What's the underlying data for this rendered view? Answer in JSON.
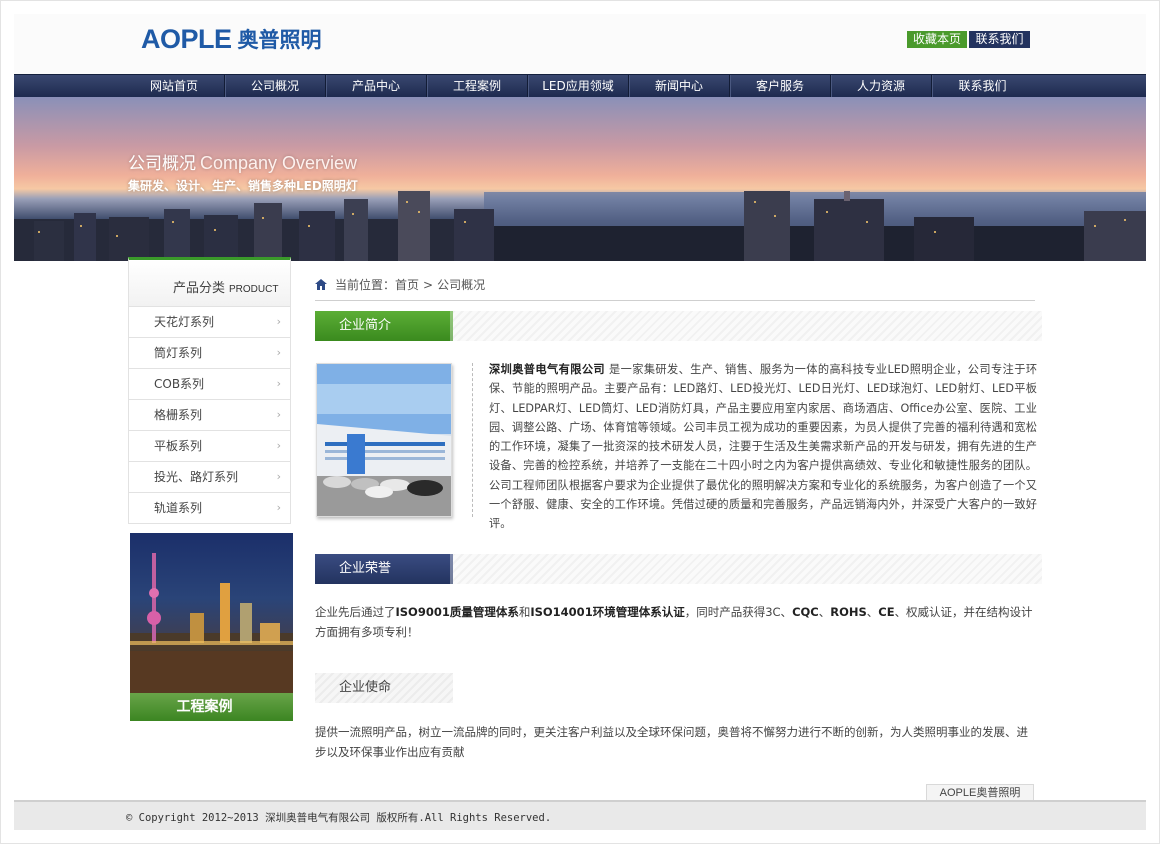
{
  "brand": {
    "logo_en": "AOPLE",
    "logo_cn": "奥普照明",
    "color": "#1f5aa6"
  },
  "toplinks": {
    "favorite": "收藏本页",
    "contact": "联系我们"
  },
  "nav": [
    "网站首页",
    "公司概况",
    "产品中心",
    "工程案例",
    "LED应用领域",
    "新闻中心",
    "客户服务",
    "人力资源",
    "联系我们"
  ],
  "banner": {
    "title_cn": "公司概况",
    "title_en": "Company Overview",
    "subtitle": "集研发、设计、生产、销售多种LED照明灯"
  },
  "sidebar": {
    "heading_cn": "产品分类",
    "heading_en": "PRODUCT",
    "items": [
      "天花灯系列",
      "筒灯系列",
      "COB系列",
      "格栅系列",
      "平板系列",
      "投光、路灯系列",
      "轨道系列"
    ],
    "project_label": "工程案例"
  },
  "breadcrumb": {
    "prefix": "当前位置：",
    "home": "首页",
    "sep": ">",
    "current": "公司概况"
  },
  "sections": {
    "intro": {
      "title": "企业简介",
      "company": "深圳奥普电气有限公司",
      "text": "是一家集研发、生产、销售、服务为一体的高科技专业LED照明企业，公司专注于环保、节能的照明产品。主要产品有：LED路灯、LED投光灯、LED日光灯、LED球泡灯、LED射灯、LED平板灯、LEDPAR灯、LED筒灯、LED消防灯具，产品主要应用室内家居、商场酒店、Office办公室、医院、工业园、调整公路、广场、体育馆等领域。公司丰员工视为成功的重要因素，为员人提供了完善的福利待遇和宽松的工作环境，凝集了一批资深的技术研发人员，注要于生活及生美需求新产品的开发与研发，拥有先进的生产设备、完善的检控系统，并培养了一支能在二十四小时之内为客户提供高绩效、专业化和敏捷性服务的团队。公司工程师团队根据客户要求为企业提供了最优化的照明解决方案和专业化的系统服务，为客户创造了一个又一个舒服、健康、安全的工作环境。凭借过硬的质量和完善服务，产品远销海内外，并深受广大客户的一致好评。"
    },
    "honor": {
      "title": "企业荣誉",
      "text_a": "企业先后通过了",
      "bold_a": "ISO9001质量管理体系",
      "text_b": "和",
      "bold_b": "ISO14001环境管理体系认证",
      "text_c": "，同时产品获得3C、",
      "bold_c": "CQC",
      "text_d": "、",
      "bold_d": "ROHS",
      "text_e": "、",
      "bold_e": "CE",
      "text_f": "、权威认证，并在结构设计方面拥有多项专利！"
    },
    "mission": {
      "title": "企业使命",
      "text": "提供一流照明产品，树立一流品牌的同时，更关注客户利益以及全球环保问题，奥普将不懈努力进行不断的创新，为人类照明事业的发展、进步以及环保事业作出应有贡献"
    }
  },
  "footer": {
    "tab": "AOPLE奥普照明",
    "copyright": "© Copyright 2012~2013 深圳奥普电气有限公司 版权所有.All Rights Reserved."
  },
  "colors": {
    "nav_bg": "#23335f",
    "green": "#4a9a2c",
    "navy": "#23335f"
  }
}
